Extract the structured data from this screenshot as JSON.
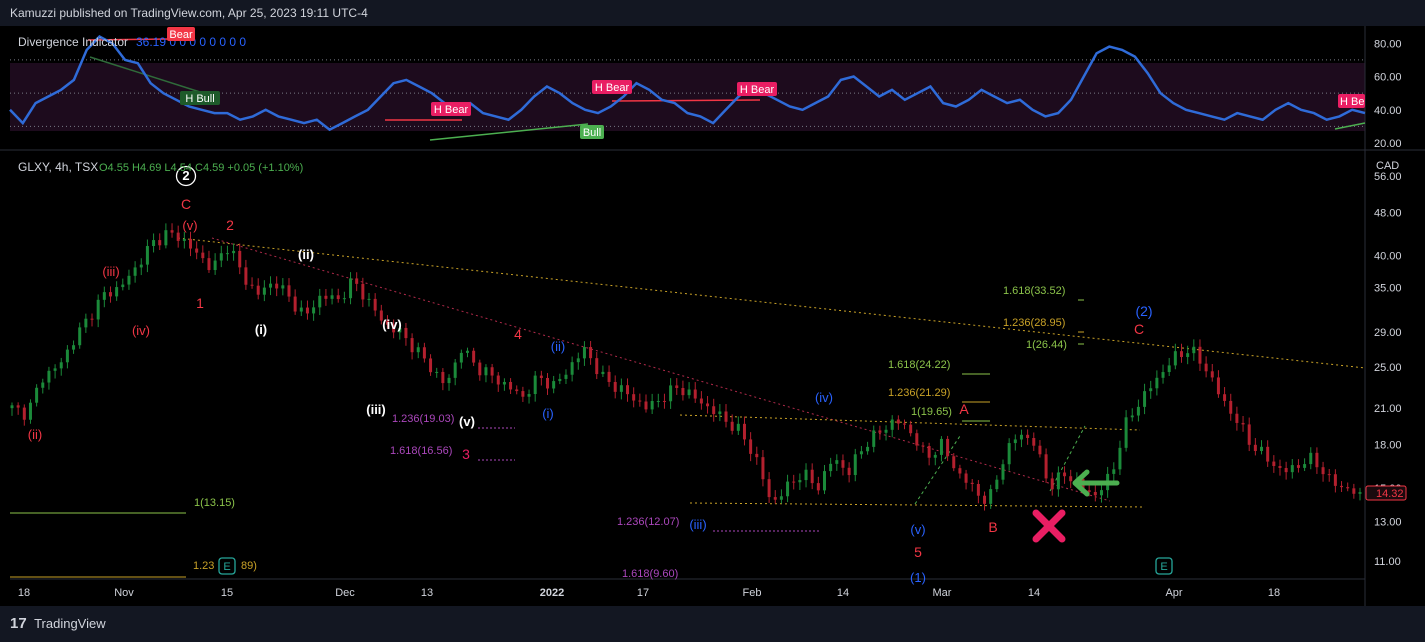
{
  "header": {
    "text": "Kamuzzi published on TradingView.com, Apr 25, 2023 19:11 UTC-4"
  },
  "footer": {
    "logo": "17",
    "brand": "TradingView"
  },
  "chart_data": [
    {
      "type": "line",
      "title": "Divergence Indicator",
      "legend_values": "36.19 0 0 0 0 0 0 0 0",
      "yticks": [
        20,
        40,
        60,
        80
      ],
      "ytick_labels": [
        "20.00",
        "40.00",
        "60.00",
        "80.00"
      ],
      "ylim": [
        17,
        88
      ],
      "levels": [
        70,
        50,
        30
      ],
      "series": [
        {
          "values": [
            40,
            32,
            44,
            48,
            52,
            58,
            76,
            84,
            80,
            70,
            68,
            56,
            50,
            46,
            42,
            40,
            38,
            38,
            34,
            36,
            40,
            36,
            34,
            32,
            34,
            28,
            32,
            36,
            40,
            48,
            56,
            58,
            54,
            50,
            44,
            40,
            44,
            38,
            36,
            34,
            40,
            48,
            54,
            50,
            44,
            40,
            38,
            42,
            48,
            56,
            52,
            46,
            44,
            38,
            36,
            32,
            40,
            48,
            54,
            50,
            46,
            42,
            40,
            44,
            48,
            58,
            60,
            54,
            48,
            52,
            46,
            50,
            54,
            44,
            42,
            46,
            52,
            48,
            44,
            46,
            40,
            36,
            38,
            46,
            60,
            74,
            78,
            76,
            72,
            62,
            50,
            44,
            40,
            38,
            36,
            34,
            38,
            36,
            34,
            40,
            44,
            40,
            38,
            34,
            36,
            40,
            38
          ]
        }
      ],
      "annotations": [
        {
          "text": "Bear",
          "kind": "bear"
        },
        {
          "text": "H Bull",
          "kind": "bull_dark"
        },
        {
          "text": "H Bear",
          "kind": "bear"
        },
        {
          "text": "H Bear",
          "kind": "bear"
        },
        {
          "text": "Bull",
          "kind": "bull"
        },
        {
          "text": "H Bear",
          "kind": "bear"
        },
        {
          "text": "H Be",
          "kind": "bear"
        }
      ]
    },
    {
      "type": "candlestick",
      "title": "GLXY, 4h, TSX",
      "ohlc_label": "O4.55 H4.69 L4.54 C4.59 +0.05 (+1.10%)",
      "currency": "CAD",
      "last_price": "14.32",
      "yscale": "log",
      "ylim": [
        10.2,
        62
      ],
      "yticks": [
        11,
        13,
        15,
        18,
        21,
        25,
        29,
        35,
        40,
        48,
        56
      ],
      "ytick_labels": [
        "11.00",
        "13.00",
        "15.00",
        "18.00",
        "21.00",
        "25.00",
        "29.00",
        "35.00",
        "40.00",
        "48.00",
        "56.00"
      ],
      "xtick_labels": [
        "18",
        "Nov",
        "15",
        "Dec",
        "13",
        "2022",
        "17",
        "Feb",
        "14",
        "Mar",
        "14",
        "Apr",
        "18"
      ],
      "close_path": [
        21,
        20.5,
        24,
        25,
        28,
        31,
        34,
        35,
        38,
        42,
        44,
        43,
        40,
        38,
        42,
        36,
        34,
        36,
        33,
        31,
        34,
        33,
        36,
        33,
        30,
        29,
        27,
        25,
        23,
        27,
        25,
        24,
        23,
        22,
        24,
        23,
        25,
        27,
        24,
        23,
        22,
        21,
        22,
        23,
        22,
        21,
        20,
        19,
        17,
        14,
        15,
        16,
        15,
        17,
        16,
        18,
        19,
        20,
        19,
        17,
        18,
        16,
        15,
        14,
        17,
        19,
        18,
        15,
        16,
        15,
        14.5,
        16,
        20,
        22,
        24,
        26,
        27,
        25,
        22,
        20,
        18,
        17,
        16,
        16.5,
        17,
        15.5,
        15,
        14.5
      ],
      "wave_labels": [
        {
          "text": "2",
          "color": "#ffffff",
          "circled": true
        },
        {
          "text": "C",
          "color": "#f23645"
        },
        {
          "text": "(v)",
          "color": "#f23645"
        },
        {
          "text": "2",
          "color": "#f23645"
        },
        {
          "text": "(iii)",
          "color": "#f23645"
        },
        {
          "text": "(iv)",
          "color": "#f23645"
        },
        {
          "text": "(ii)",
          "color": "#f23645"
        },
        {
          "text": "1",
          "color": "#f23645"
        },
        {
          "text": "(ii)",
          "color": "#ffffff"
        },
        {
          "text": "(i)",
          "color": "#ffffff"
        },
        {
          "text": "(iv)",
          "color": "#ffffff"
        },
        {
          "text": "(iii)",
          "color": "#ffffff"
        },
        {
          "text": "(v)",
          "color": "#ffffff"
        },
        {
          "text": "4",
          "color": "#f23645"
        },
        {
          "text": "(ii)",
          "color": "#2962ff"
        },
        {
          "text": "(i)",
          "color": "#2962ff"
        },
        {
          "text": "3",
          "color": "#e91e63"
        },
        {
          "text": "(iii)",
          "color": "#2962ff"
        },
        {
          "text": "(iv)",
          "color": "#2962ff"
        },
        {
          "text": "(v)",
          "color": "#2962ff"
        },
        {
          "text": "5",
          "color": "#f23645"
        },
        {
          "text": "(1)",
          "color": "#2962ff"
        },
        {
          "text": "A",
          "color": "#f23645"
        },
        {
          "text": "B",
          "color": "#f23645"
        },
        {
          "text": "(2)",
          "color": "#2962ff"
        },
        {
          "text": "C",
          "color": "#f23645"
        }
      ],
      "fib_labels": [
        {
          "text": "1.236(19.03)",
          "color": "#ab47bc"
        },
        {
          "text": "1.618(16.56)",
          "color": "#ab47bc"
        },
        {
          "text": "1(13.15)",
          "color": "#8bc34a"
        },
        {
          "text": "1.236(12.07)",
          "color": "#ab47bc"
        },
        {
          "text": "1.618(9.60)",
          "color": "#ab47bc"
        },
        {
          "text": "1.23",
          "color": "#c9a227"
        },
        {
          "text": "89)",
          "color": "#c9a227"
        },
        {
          "text": "1.618(33.52)",
          "color": "#8bc34a"
        },
        {
          "text": "1.236(28.95)",
          "color": "#c9a227"
        },
        {
          "text": "1(26.44)",
          "color": "#8bc34a"
        },
        {
          "text": "1.618(24.22)",
          "color": "#8bc34a"
        },
        {
          "text": "1.236(21.29)",
          "color": "#c9a227"
        },
        {
          "text": "1(19.65)",
          "color": "#8bc34a"
        }
      ],
      "event_markers": [
        "E",
        "E"
      ],
      "grid": false
    }
  ]
}
